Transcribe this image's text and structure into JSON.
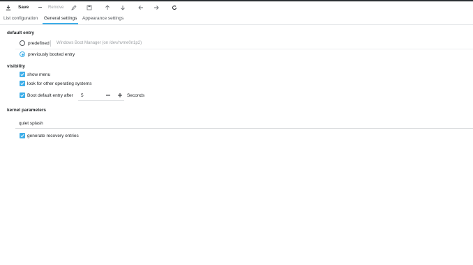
{
  "toolbar": {
    "save_label": "Save",
    "remove_label": "Remove",
    "icons": [
      "download-icon",
      "minus-icon",
      "pencil-icon",
      "save-file-icon",
      "arrow-up-icon",
      "arrow-down-icon",
      "arrow-left-icon",
      "arrow-right-icon",
      "refresh-icon"
    ]
  },
  "tabs": [
    {
      "label": "List configuration",
      "active": false
    },
    {
      "label": "General settings",
      "active": true
    },
    {
      "label": "Appearance settings",
      "active": false
    }
  ],
  "default_entry": {
    "heading": "default entry",
    "predefined_label": "predefined",
    "predefined_value": "Windows Boot Manager (on /dev/nvme0n1p2)",
    "previously_label": "previously booted entry",
    "selected": "previously booted entry"
  },
  "visibility": {
    "heading": "visibility",
    "show_menu": {
      "label": "show menu",
      "checked": true
    },
    "look_for_os": {
      "label": "look for other operating systems",
      "checked": true
    },
    "boot_default": {
      "label": "Boot default entry after",
      "checked": true,
      "value": "5",
      "unit": "Seconds"
    }
  },
  "kernel": {
    "heading": "kernel parameters",
    "value": "quiet splash",
    "recovery": {
      "label": "generate recovery entries",
      "checked": true
    }
  },
  "colors": {
    "accent": "#3daee9",
    "text": "#232629",
    "disabled": "#9b9fa3"
  }
}
